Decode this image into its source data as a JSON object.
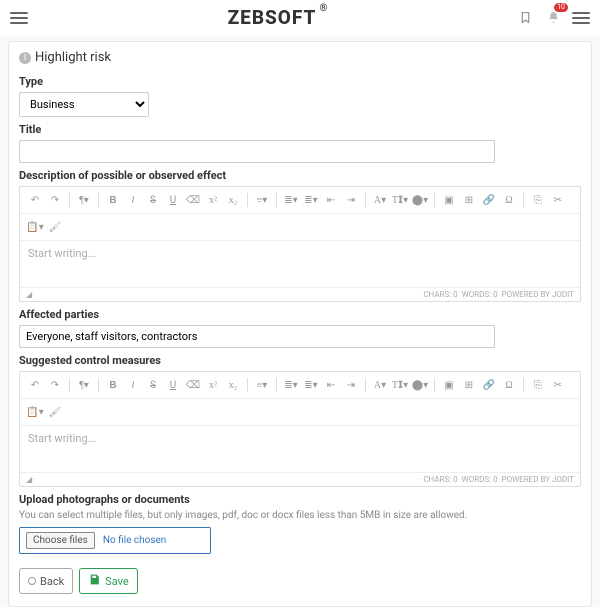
{
  "header": {
    "brand": "ZEBSOFT",
    "brand_sup": "®",
    "notif_count": "10"
  },
  "page": {
    "title": "Highlight risk"
  },
  "form": {
    "type_label": "Type",
    "type_value": "Business",
    "title_label": "Title",
    "title_value": "",
    "desc_label": "Description of possible or observed effect",
    "editor_placeholder": "Start writing...",
    "editor_status_chars": "CHARS: 0",
    "editor_status_words": "WORDS: 0",
    "editor_powered": "POWERED BY JODIT",
    "affected_label": "Affected parties",
    "affected_value": "Everyone, staff visitors, contractors",
    "suggested_label": "Suggested control measures",
    "upload_label": "Upload photographs or documents",
    "upload_hint": "You can select multiple files, but only images, pdf, doc or docx files less than 5MB in size are allowed.",
    "choose_files": "Choose files",
    "no_file": "No file chosen",
    "back": "Back",
    "save": "Save"
  }
}
